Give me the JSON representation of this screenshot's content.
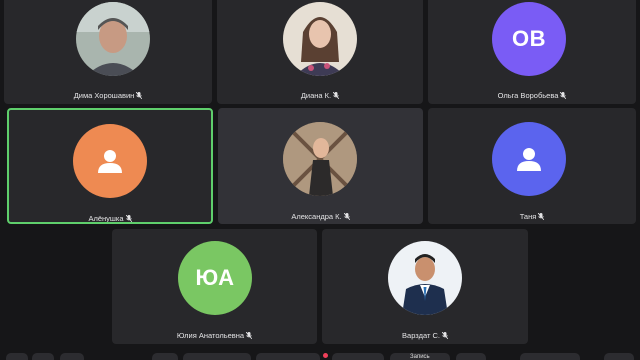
{
  "participants": [
    {
      "name": "Дима Хорошавин",
      "initials": "",
      "avatar_bg": "#9aa6a8",
      "muted": true
    },
    {
      "name": "Диана К.",
      "initials": "",
      "avatar_bg": "#d8cfc6",
      "muted": true
    },
    {
      "name": "Ольга Воробьева",
      "initials": "ОВ",
      "avatar_bg": "#7a5cf5",
      "muted": true
    },
    {
      "name": "Алёнушка",
      "initials": "",
      "avatar_bg": "#ee8a52",
      "muted": true,
      "active_speaker": true
    },
    {
      "name": "Александра К.",
      "initials": "",
      "avatar_bg": "#8c7763",
      "muted": true
    },
    {
      "name": "Таня",
      "initials": "",
      "avatar_bg": "#5b64ee",
      "muted": true
    },
    {
      "name": "Юлия Анатольевна",
      "initials": "ЮА",
      "avatar_bg": "#7ac763",
      "muted": true
    },
    {
      "name": "Варздат С.",
      "initials": "",
      "avatar_bg": "#e9eef3",
      "muted": true
    }
  ],
  "toolbar": {
    "partial_label": "Запись",
    "accent_color": "#f0405a"
  },
  "colors": {
    "active_border": "#5fcf6c",
    "tile": "#28282b",
    "background": "#161618"
  }
}
